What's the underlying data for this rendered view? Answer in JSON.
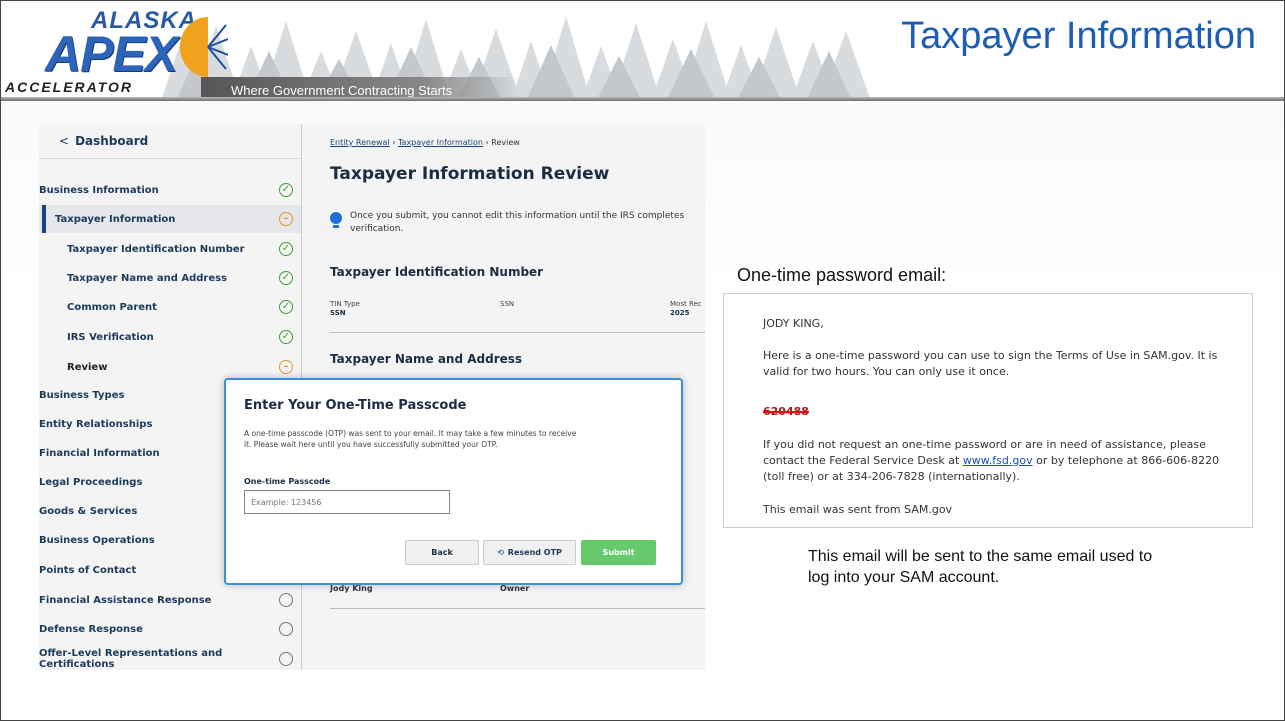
{
  "header": {
    "logo_top": "ALASKA",
    "logo_main": "APEX",
    "logo_bottom": "ACCELERATOR",
    "tagline": "Where Government Contracting Starts",
    "title": "Taxpayer Information"
  },
  "sidebar": {
    "dashboard": "Dashboard",
    "items": [
      {
        "label": "Business Information",
        "status": "complete"
      },
      {
        "label": "Taxpayer Information",
        "status": "in-progress"
      },
      {
        "label": "Taxpayer Identification Number",
        "status": "complete"
      },
      {
        "label": "Taxpayer Name and Address",
        "status": "complete"
      },
      {
        "label": "Common Parent",
        "status": "complete"
      },
      {
        "label": "IRS Verification",
        "status": "complete"
      },
      {
        "label": "Review",
        "status": "in-progress"
      },
      {
        "label": "Business Types",
        "status": "hidden"
      },
      {
        "label": "Entity Relationships",
        "status": "hidden"
      },
      {
        "label": "Financial Information",
        "status": "hidden"
      },
      {
        "label": "Legal Proceedings",
        "status": "hidden"
      },
      {
        "label": "Goods & Services",
        "status": "hidden"
      },
      {
        "label": "Business Operations",
        "status": "hidden"
      },
      {
        "label": "Points of Contact",
        "status": "hidden"
      },
      {
        "label": "Financial Assistance Response",
        "status": "not-started"
      },
      {
        "label": "Defense Response",
        "status": "not-started"
      },
      {
        "label": "Offer-Level Representations and Certifications",
        "status": "not-started"
      }
    ]
  },
  "main": {
    "crumb_1": "Entity Renewal",
    "crumb_2": "Taxpayer Information",
    "crumb_3": "Review",
    "crumb_sep": "›",
    "title": "Taxpayer Information Review",
    "notice": "Once you submit, you cannot edit this information until the IRS completes verification.",
    "tin_heading": "Taxpayer Identification Number",
    "tin_type_label": "TIN Type",
    "tin_type_value": "SSN",
    "ssn_label": "SSN",
    "most_recent_label": "Most Rec",
    "most_recent_value": "2025",
    "name_heading": "Taxpayer Name and Address",
    "contact_name": "Jody King",
    "contact_role": "Owner"
  },
  "modal": {
    "title": "Enter Your One-Time Passcode",
    "description": "A one-time passcode (OTP) was sent to your email. It may take a few minutes to receive it. Please wait here until you have successfully submitted your OTP.",
    "field_label": "One-time Passcode",
    "field_placeholder": "Example: 123456",
    "back": "Back",
    "resend": "Resend OTP",
    "submit": "Submit"
  },
  "email": {
    "heading": "One-time password email:",
    "greeting": "JODY KING,",
    "para1": "Here is a one-time password you can use to sign the Terms of Use in SAM.gov. It is valid for two hours. You can only use it once.",
    "code": "620488",
    "para2_a": "If you did not request an one-time password or are in need of assistance, please contact the Federal Service Desk at ",
    "para2_link": "www.fsd.gov",
    "para2_b": " or by telephone at 866-606-8220 (toll free) or at 334-206-7828 (internationally).",
    "footer": "This email was sent from SAM.gov",
    "caption": "This email will be sent to the same email used to log into your SAM account."
  },
  "colors": {
    "title_blue": "#1e5db4",
    "complete_green": "#3a9f3a",
    "progress_orange": "#e3962b",
    "submit_green": "#67c96d",
    "modal_border": "#3b8fe0",
    "code_red": "#e01010"
  }
}
